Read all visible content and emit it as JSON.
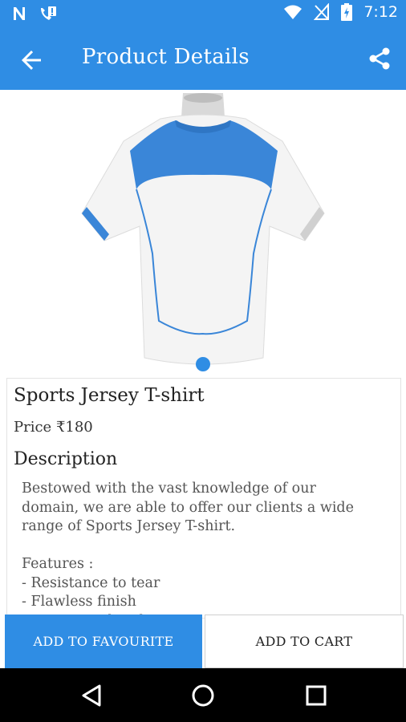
{
  "status_bar": {
    "time": "7:12",
    "icons": [
      "n-notification-icon",
      "phone-missed-icon",
      "wifi-icon",
      "no-signal-icon",
      "battery-charging-icon"
    ]
  },
  "app_bar": {
    "title": "Product Details",
    "back_icon": "arrow-back-icon",
    "share_icon": "share-icon"
  },
  "product": {
    "image": "sports-jersey-back-view",
    "name": "Sports Jersey T-shirt",
    "price_label": "Price",
    "price": "₹180",
    "description_heading": "Description",
    "description_lines": [
      "Bestowed with the vast knowledge of our",
      "domain, we are able to offer our clients a wide",
      "range of Sports Jersey T-shirt."
    ],
    "features_heading": "Features :",
    "features": [
      "- Resistance to tear",
      "- Flawless finish",
      "- Moisture absorbent"
    ]
  },
  "actions": {
    "favourite_label": "ADD TO FAVOURITE",
    "cart_label": "ADD TO CART"
  },
  "navigation": [
    "back-triangle-icon",
    "home-circle-icon",
    "recents-square-icon"
  ],
  "colors": {
    "accent": "#2f8de4",
    "jersey_blue": "#3a86d8",
    "nav_bar": "#000000"
  }
}
